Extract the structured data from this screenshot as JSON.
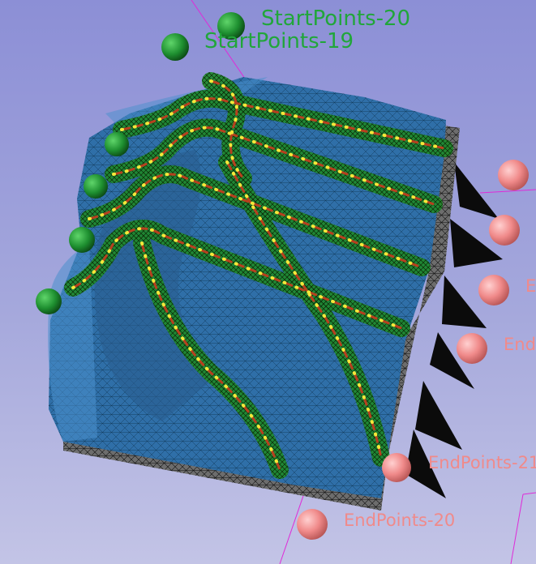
{
  "colors": {
    "background_top": "#8c8fd6",
    "background_bottom": "#c3c4e6",
    "surface": "#2f6fa8",
    "mesh": "#000000",
    "tube": "#1f8a2a",
    "centerline": "#b8401e",
    "start_point": "#1e8f30",
    "end_point": "#f08a8a",
    "start_label": "#21a63a",
    "end_label": "#f08a8a"
  },
  "labels": {
    "start_20": "StartPoints-20",
    "start_19": "StartPoints-19",
    "end_21": "EndPoints-21",
    "end_20": "EndPoints-20",
    "end_partial_a": "E",
    "end_partial_b": "End"
  }
}
